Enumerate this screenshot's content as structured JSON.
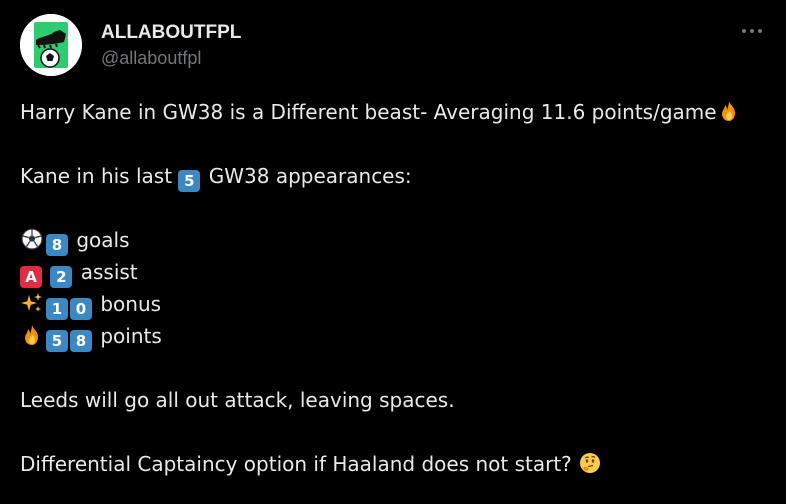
{
  "account": {
    "display_name": "ALLABOUTFPL",
    "handle": "@allaboutfpl"
  },
  "tweet": {
    "line1": "Harry Kane in GW38 is a Different beast- Averaging 11.6 points/game",
    "line2_before": "Kane in his last ",
    "line2_num": "5",
    "line2_after": " GW38 appearances:",
    "stats": [
      {
        "icon": "soccer-ball-icon",
        "digits": [
          "8"
        ],
        "label": "goals"
      },
      {
        "icon": "letter-a-icon",
        "badge": "A",
        "digits": [
          "2"
        ],
        "label": "assist"
      },
      {
        "icon": "sparkles-icon",
        "digits": [
          "1",
          "0"
        ],
        "label": "bonus"
      },
      {
        "icon": "fire-icon",
        "digits": [
          "5",
          "8"
        ],
        "label": "points"
      }
    ],
    "line_leeds": "Leeds will go all out attack, leaving spaces.",
    "line_last": "Differential Captaincy option if Haaland does not start? "
  },
  "icons": {
    "avatar": "football-boot-and-ball-logo",
    "more": "more-options-icon",
    "fire": "fire-icon",
    "thinking": "thinking-face-icon"
  },
  "colors": {
    "background": "#000000",
    "text": "#e7e9ea",
    "secondary": "#71767b",
    "keycap": "#3b88c3",
    "badge_a": "#dd2e44",
    "avatar_green": "#2ecc71"
  }
}
